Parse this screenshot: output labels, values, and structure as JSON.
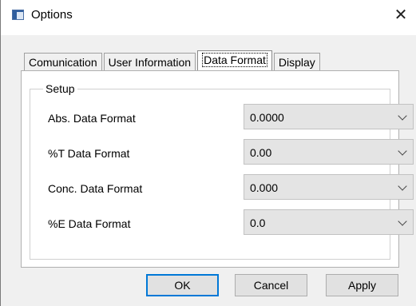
{
  "window": {
    "title": "Options",
    "close_glyph": "✕"
  },
  "tabs": [
    {
      "label": "Comunication",
      "active": false
    },
    {
      "label": "User Information",
      "active": false
    },
    {
      "label": "Data Format",
      "active": true
    },
    {
      "label": "Display",
      "active": false
    }
  ],
  "setup": {
    "label": "Setup",
    "rows": [
      {
        "label": "Abs. Data Format",
        "value": "0.0000"
      },
      {
        "label": "%T Data Format",
        "value": "0.00"
      },
      {
        "label": "Conc. Data Format",
        "value": "0.000"
      },
      {
        "label": "%E Data Format",
        "value": "0.0"
      }
    ]
  },
  "buttons": {
    "ok": "OK",
    "cancel": "Cancel",
    "apply": "Apply"
  },
  "colors": {
    "accent": "#0078d7",
    "window_bg": "#f0f0f0"
  }
}
